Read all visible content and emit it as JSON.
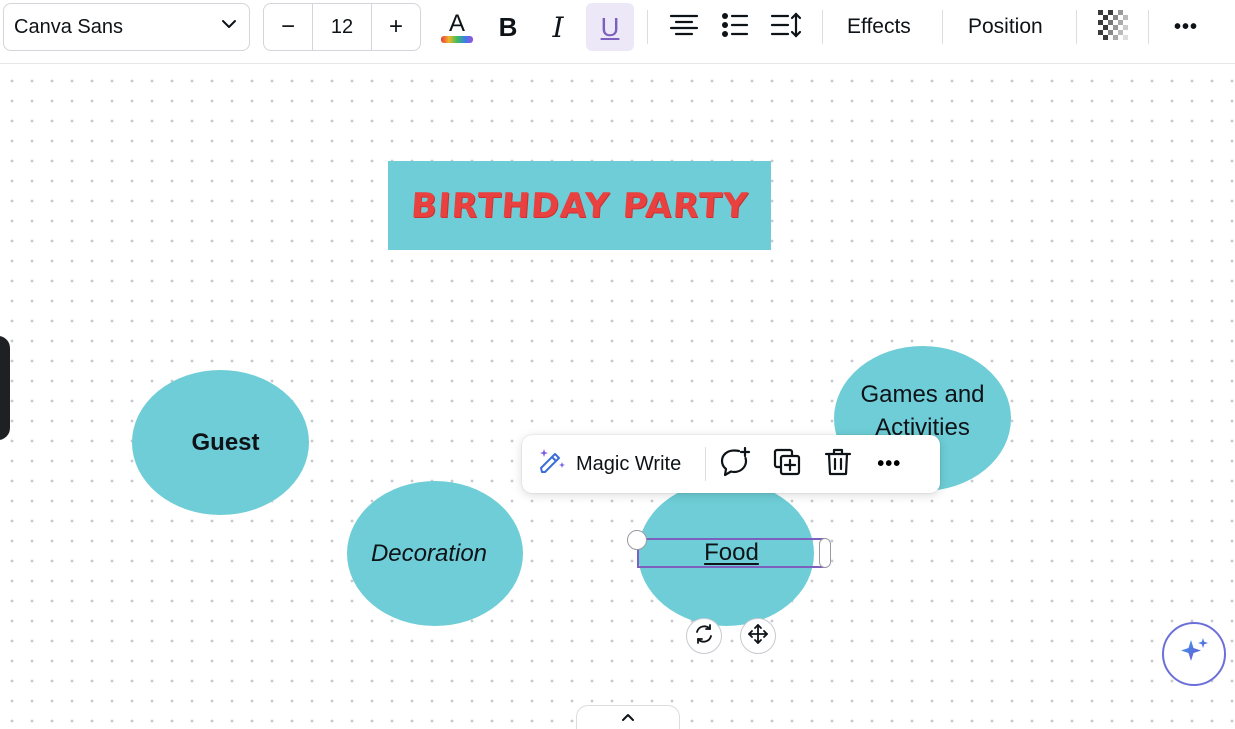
{
  "toolbar": {
    "font_name": "Canva Sans",
    "font_size": "12",
    "decrease_label": "−",
    "increase_label": "+",
    "bold_label": "B",
    "italic_label": "I",
    "underline_label": "U",
    "text_color_label": "A",
    "effects_label": "Effects",
    "position_label": "Position",
    "more_label": "•••"
  },
  "canvas": {
    "title": "BIRTHDAY PARTY",
    "bubbles": {
      "guest": "Guest",
      "decoration": "Decoration",
      "games_line1": "Games and",
      "games_line2": "Activities",
      "food": "Food"
    }
  },
  "context_menu": {
    "magic_write_label": "Magic Write",
    "more_label": "•••"
  },
  "colors": {
    "bubble": "#6ecdd6",
    "title_text": "#e8413f",
    "selection": "#7d5fbd",
    "underline_active_bg": "#ece8f8"
  },
  "icons": [
    "chevron-down-icon",
    "text-color-icon",
    "bold-icon",
    "italic-icon",
    "underline-icon",
    "align-center-icon",
    "bullet-list-icon",
    "line-spacing-icon",
    "transparency-icon",
    "more-icon",
    "magic-write-icon",
    "comment-add-icon",
    "duplicate-icon",
    "trash-icon",
    "rotate-icon",
    "move-icon",
    "sparkle-icon",
    "chevron-up-icon"
  ]
}
